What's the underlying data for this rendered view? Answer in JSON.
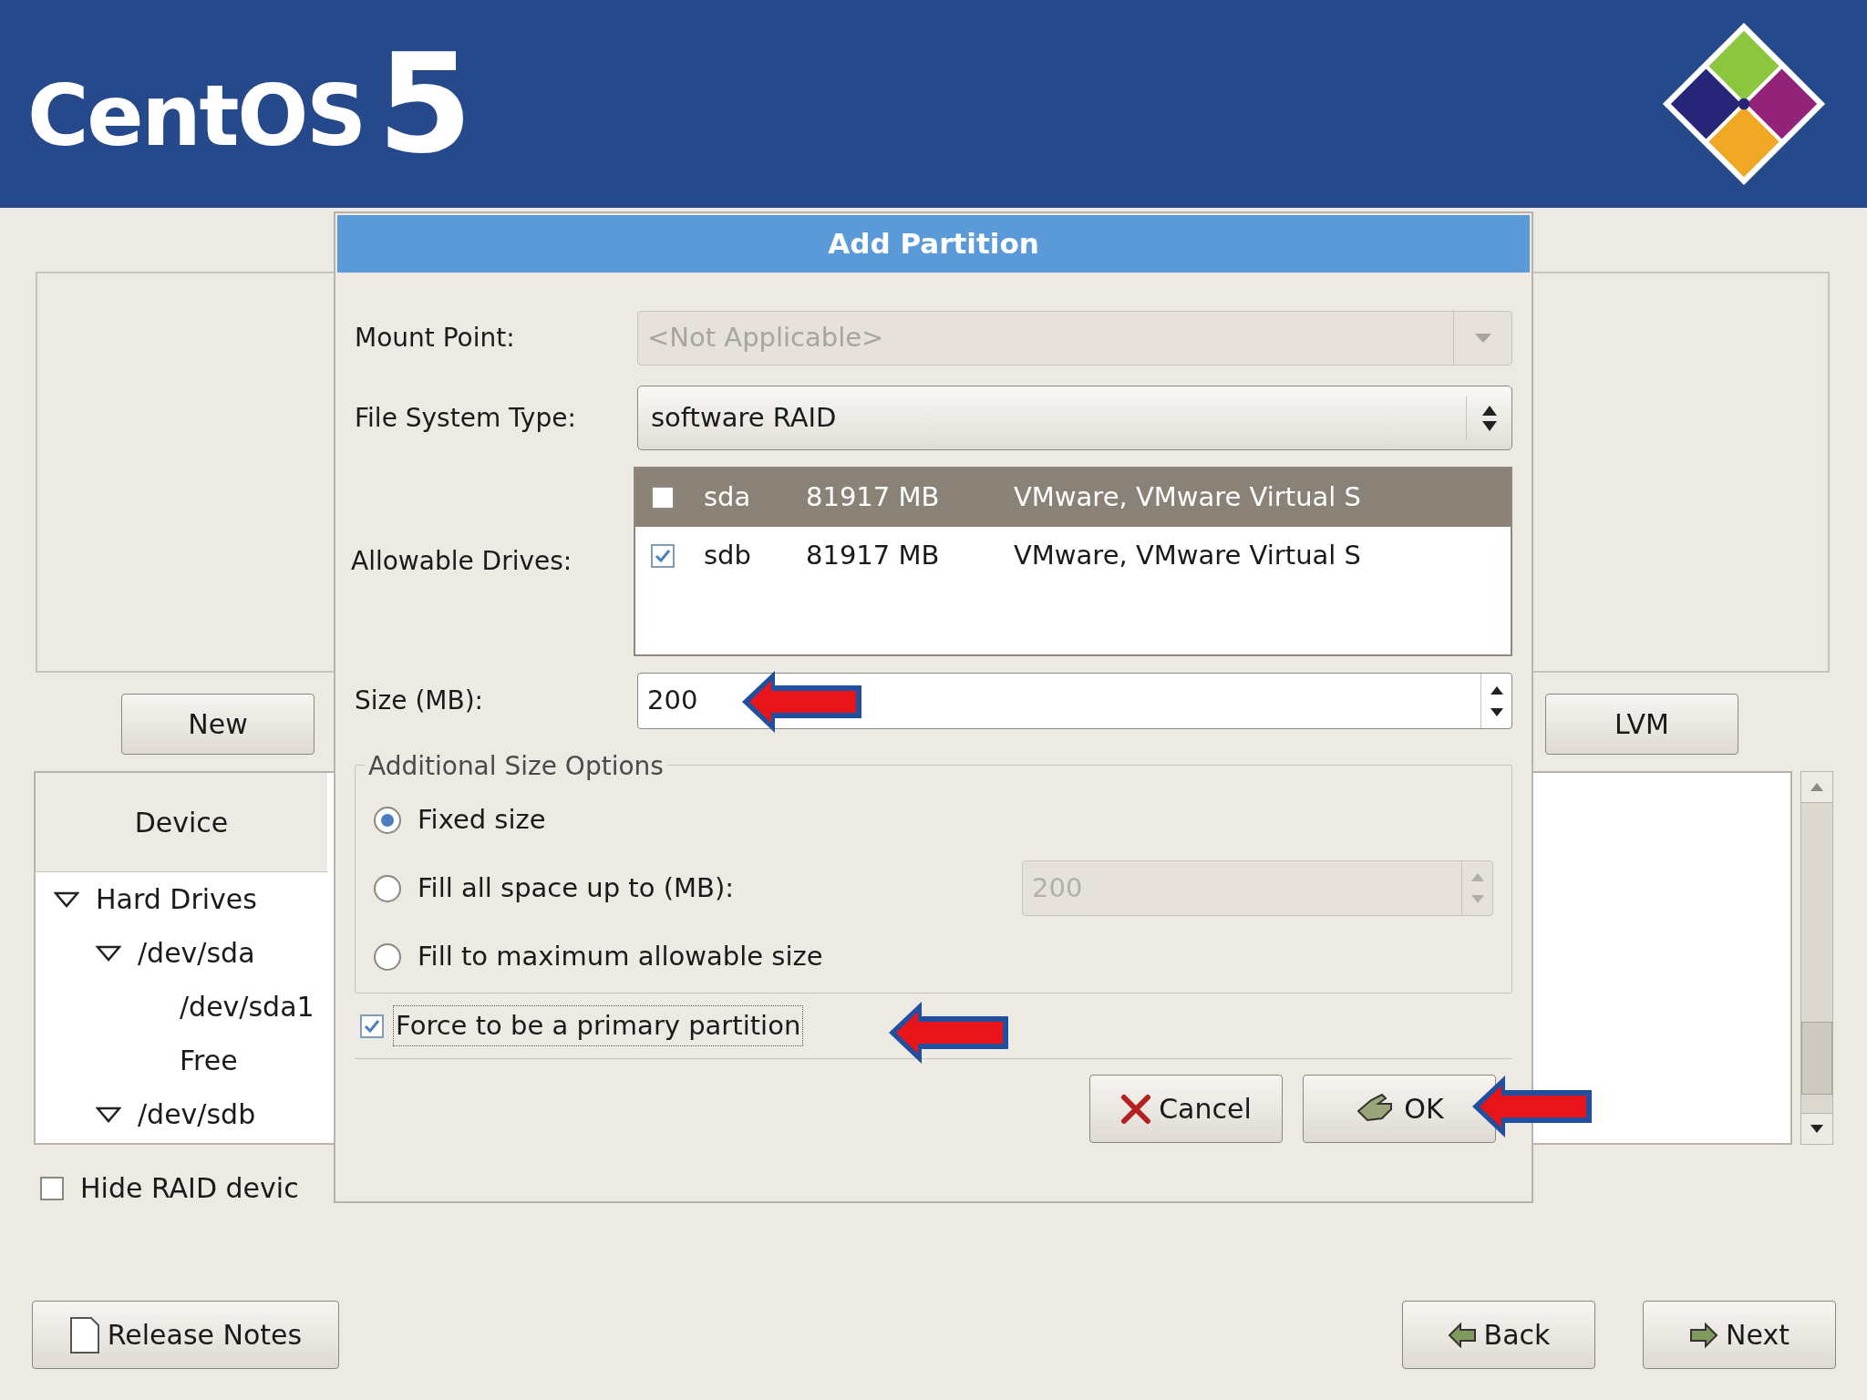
{
  "header": {
    "logo_name": "CentOS",
    "logo_version": "5"
  },
  "main": {
    "buttons": [
      {
        "label": "New"
      },
      {
        "label": "LVM"
      }
    ],
    "tree_header": "Device",
    "tree": [
      {
        "label": "Hard Drives",
        "expanded": true,
        "children": [
          {
            "label": "/dev/sda",
            "expanded": true,
            "children": [
              {
                "label": "/dev/sda1"
              },
              {
                "label": "Free"
              }
            ]
          },
          {
            "label": "/dev/sdb",
            "expanded": true
          }
        ]
      }
    ],
    "hide_option": {
      "label": "Hide RAID devic",
      "checked": false
    }
  },
  "dialog": {
    "title": "Add Partition",
    "mount_point": {
      "label": "Mount Point:",
      "value": "<Not Applicable>",
      "disabled": true
    },
    "fs_type": {
      "label": "File System Type:",
      "value": "software RAID"
    },
    "drives": {
      "label": "Allowable Drives:",
      "rows": [
        {
          "name": "sda",
          "size": "81917 MB",
          "model": "VMware, VMware Virtual S",
          "checked": false,
          "selected": true
        },
        {
          "name": "sdb",
          "size": "81917 MB",
          "model": "VMware, VMware Virtual S",
          "checked": true,
          "selected": false
        }
      ]
    },
    "size": {
      "label": "Size (MB):",
      "value": "200"
    },
    "size_options": {
      "title": "Additional Size Options",
      "options": [
        {
          "label": "Fixed size",
          "selected": true
        },
        {
          "label": "Fill all space up to (MB):",
          "selected": false,
          "spin_value": "200",
          "spin_disabled": true
        },
        {
          "label": "Fill to maximum allowable size",
          "selected": false
        }
      ]
    },
    "force_primary": {
      "label": "Force to be a primary partition",
      "checked": true
    },
    "buttons": [
      {
        "label": "Cancel",
        "kind": "cancel"
      },
      {
        "label": "OK",
        "kind": "ok"
      }
    ]
  },
  "annotations": [
    {
      "kind": "arrow"
    },
    {
      "kind": "arrow"
    },
    {
      "kind": "arrow"
    }
  ],
  "footer_buttons": [
    {
      "label": "Release Notes",
      "kind": "notes"
    },
    {
      "label": "Back",
      "kind": "back"
    },
    {
      "label": "Next",
      "kind": "next"
    }
  ]
}
